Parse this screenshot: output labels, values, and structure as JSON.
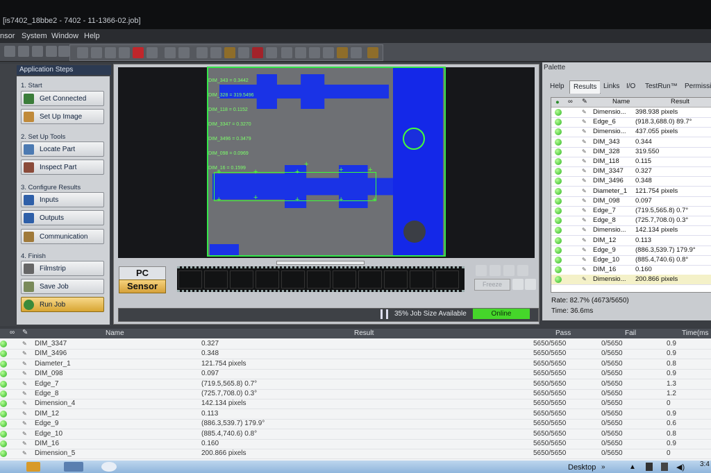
{
  "window": {
    "title": "[is7402_18bbe2 - 7402 - 11-1366-02.job]"
  },
  "menu": [
    "nsor",
    "System",
    "Window",
    "Help"
  ],
  "app_steps": {
    "title": "Application Steps",
    "sections": [
      {
        "label": "1. Start",
        "items": [
          "Get Connected",
          "Set Up Image"
        ]
      },
      {
        "label": "2. Set Up Tools",
        "items": [
          "Locate Part",
          "Inspect Part"
        ]
      },
      {
        "label": "3. Configure Results",
        "items": [
          "Inputs",
          "Outputs",
          "Communication"
        ]
      },
      {
        "label": "4. Finish",
        "items": [
          "Filmstrip",
          "Save Job",
          "Run Job"
        ]
      }
    ]
  },
  "viewer": {
    "overlay_lines": [
      "DIM_343 = 0.3442",
      "DIM_328 = 319.5496",
      "DIM_118 = 0.1152",
      "DIM_3347 = 0.3270",
      "DIM_3496 = 0.3479",
      "DIM_098 = 0.0969",
      "DIM_16 = 0.1599"
    ],
    "pc_label": "PC",
    "sensor_label": "Sensor",
    "freeze_label": "Freeze",
    "job_size": "35% Job Size Available",
    "status": "Online"
  },
  "palette": {
    "title": "Palette",
    "tabs": [
      "Help",
      "Results",
      "Links",
      "I/O",
      "TestRun™",
      "Permissi"
    ],
    "columns": {
      "name": "Name",
      "result": "Result"
    },
    "rows": [
      {
        "name": "Dimensio...",
        "result": "398.938 pixels"
      },
      {
        "name": "Edge_6",
        "result": "(918.3,688.0) 89.7°"
      },
      {
        "name": "Dimensio...",
        "result": "437.055 pixels"
      },
      {
        "name": "DIM_343",
        "result": "0.344"
      },
      {
        "name": "DIM_328",
        "result": "319.550"
      },
      {
        "name": "DIM_118",
        "result": "0.115"
      },
      {
        "name": "DIM_3347",
        "result": "0.327"
      },
      {
        "name": "DIM_3496",
        "result": "0.348"
      },
      {
        "name": "Diameter_1",
        "result": "121.754 pixels"
      },
      {
        "name": "DIM_098",
        "result": "0.097"
      },
      {
        "name": "Edge_7",
        "result": "(719.5,565.8) 0.7°"
      },
      {
        "name": "Edge_8",
        "result": "(725.7,708.0) 0.3°"
      },
      {
        "name": "Dimensio...",
        "result": "142.134 pixels"
      },
      {
        "name": "DIM_12",
        "result": "0.113"
      },
      {
        "name": "Edge_9",
        "result": "(886.3,539.7) 179.9°"
      },
      {
        "name": "Edge_10",
        "result": "(885.4,740.6) 0.8°"
      },
      {
        "name": "DIM_16",
        "result": "0.160"
      },
      {
        "name": "Dimensio...",
        "result": "200.866 pixels"
      }
    ],
    "rate": "Rate: 82.7% (4673/5650)",
    "time": "Time: 36.6ms"
  },
  "bottom_table": {
    "columns": {
      "name": "Name",
      "result": "Result",
      "pass": "Pass",
      "fail": "Fail",
      "time": "Time(ms"
    },
    "rows": [
      {
        "name": "DIM_3347",
        "result": "0.327",
        "pass": "5650/5650",
        "fail": "0/5650",
        "time": "0.9"
      },
      {
        "name": "DIM_3496",
        "result": "0.348",
        "pass": "5650/5650",
        "fail": "0/5650",
        "time": "0.9"
      },
      {
        "name": "Diameter_1",
        "result": "121.754 pixels",
        "pass": "5650/5650",
        "fail": "0/5650",
        "time": "0.8"
      },
      {
        "name": "DIM_098",
        "result": "0.097",
        "pass": "5650/5650",
        "fail": "0/5650",
        "time": "0.9"
      },
      {
        "name": "Edge_7",
        "result": "(719.5,565.8) 0.7°",
        "pass": "5650/5650",
        "fail": "0/5650",
        "time": "1.3"
      },
      {
        "name": "Edge_8",
        "result": "(725.7,708.0) 0.3°",
        "pass": "5650/5650",
        "fail": "0/5650",
        "time": "1.2"
      },
      {
        "name": "Dimension_4",
        "result": "142.134 pixels",
        "pass": "5650/5650",
        "fail": "0/5650",
        "time": "0"
      },
      {
        "name": "DIM_12",
        "result": "0.113",
        "pass": "5650/5650",
        "fail": "0/5650",
        "time": "0.9"
      },
      {
        "name": "Edge_9",
        "result": "(886.3,539.7) 179.9°",
        "pass": "5650/5650",
        "fail": "0/5650",
        "time": "0.6"
      },
      {
        "name": "Edge_10",
        "result": "(885.4,740.6) 0.8°",
        "pass": "5650/5650",
        "fail": "0/5650",
        "time": "0.8"
      },
      {
        "name": "DIM_16",
        "result": "0.160",
        "pass": "5650/5650",
        "fail": "0/5650",
        "time": "0.9"
      },
      {
        "name": "Dimension_5",
        "result": "200.866 pixels",
        "pass": "5650/5650",
        "fail": "0/5650",
        "time": "0"
      }
    ]
  },
  "taskbar": {
    "desktop": "Desktop",
    "clock": "3:4"
  },
  "colors": {
    "accent_blue": "#1a33e6",
    "overlay_green": "#34e84a",
    "online_green": "#45d62a",
    "active_step": "#f2c25a"
  }
}
